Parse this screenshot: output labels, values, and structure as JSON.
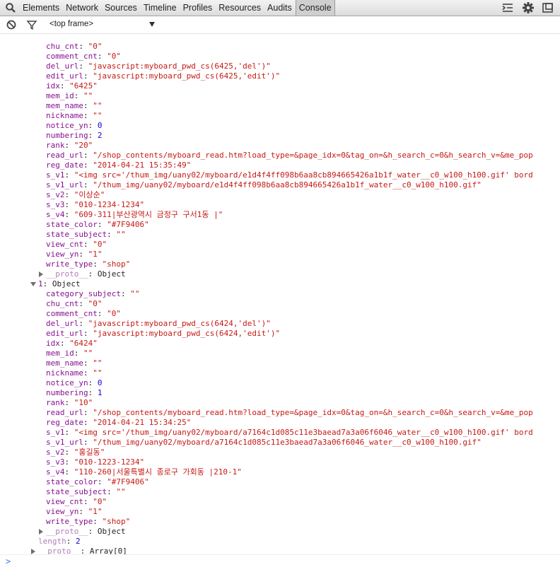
{
  "toolbar": {
    "tabs": [
      "Elements",
      "Network",
      "Sources",
      "Timeline",
      "Profiles",
      "Resources",
      "Audits",
      "Console"
    ],
    "active_tab": "Console"
  },
  "filterbar": {
    "frame_label": "<top frame>"
  },
  "console": {
    "obj0": [
      {
        "k": "chu_cnt",
        "v": "\"0\"",
        "t": "s"
      },
      {
        "k": "comment_cnt",
        "v": "\"0\"",
        "t": "s"
      },
      {
        "k": "del_url",
        "v": "\"javascript:myboard_pwd_cs(6425,'del')\"",
        "t": "s"
      },
      {
        "k": "edit_url",
        "v": "\"javascript:myboard_pwd_cs(6425,'edit')\"",
        "t": "s"
      },
      {
        "k": "idx",
        "v": "\"6425\"",
        "t": "s"
      },
      {
        "k": "mem_id",
        "v": "\"\"",
        "t": "s"
      },
      {
        "k": "mem_name",
        "v": "\"\"",
        "t": "s"
      },
      {
        "k": "nickname",
        "v": "\"\"",
        "t": "s"
      },
      {
        "k": "notice_yn",
        "v": "0",
        "t": "n"
      },
      {
        "k": "numbering",
        "v": "2",
        "t": "n"
      },
      {
        "k": "rank",
        "v": "\"20\"",
        "t": "s"
      },
      {
        "k": "read_url",
        "v": "\"/shop_contents/myboard_read.htm?load_type=&page_idx=0&tag_on=&h_search_c=0&h_search_v=&me_pop",
        "t": "s"
      },
      {
        "k": "reg_date",
        "v": "\"2014-04-21 15:35:49\"",
        "t": "s"
      },
      {
        "k": "s_v1",
        "v": "\"<img src='/thum_img/uany02/myboard/e1d4f4ff098b6aa8cb894665426a1b1f_water__c0_w100_h100.gif' bord",
        "t": "s"
      },
      {
        "k": "s_v1_url",
        "v": "\"/thum_img/uany02/myboard/e1d4f4ff098b6aa8cb894665426a1b1f_water__c0_w100_h100.gif\"",
        "t": "s"
      },
      {
        "k": "s_v2",
        "v": "\"이상순\"",
        "t": "s"
      },
      {
        "k": "s_v3",
        "v": "\"010-1234-1234\"",
        "t": "s"
      },
      {
        "k": "s_v4",
        "v": "\"609-311|부산광역시 금정구 구서1동 |\"",
        "t": "s"
      },
      {
        "k": "state_color",
        "v": "\"#7F9406\"",
        "t": "s"
      },
      {
        "k": "state_subject",
        "v": "\"\"",
        "t": "s"
      },
      {
        "k": "view_cnt",
        "v": "\"0\"",
        "t": "s"
      },
      {
        "k": "view_yn",
        "v": "\"1\"",
        "t": "s"
      },
      {
        "k": "write_type",
        "v": "\"shop\"",
        "t": "s"
      }
    ],
    "proto_label": "__proto__",
    "proto_object": "Object",
    "obj1_header_key": "1",
    "obj1_header_val": "Object",
    "obj1": [
      {
        "k": "category_subject",
        "v": "\"\"",
        "t": "s"
      },
      {
        "k": "chu_cnt",
        "v": "\"0\"",
        "t": "s"
      },
      {
        "k": "comment_cnt",
        "v": "\"0\"",
        "t": "s"
      },
      {
        "k": "del_url",
        "v": "\"javascript:myboard_pwd_cs(6424,'del')\"",
        "t": "s"
      },
      {
        "k": "edit_url",
        "v": "\"javascript:myboard_pwd_cs(6424,'edit')\"",
        "t": "s"
      },
      {
        "k": "idx",
        "v": "\"6424\"",
        "t": "s"
      },
      {
        "k": "mem_id",
        "v": "\"\"",
        "t": "s"
      },
      {
        "k": "mem_name",
        "v": "\"\"",
        "t": "s"
      },
      {
        "k": "nickname",
        "v": "\"\"",
        "t": "s"
      },
      {
        "k": "notice_yn",
        "v": "0",
        "t": "n"
      },
      {
        "k": "numbering",
        "v": "1",
        "t": "n"
      },
      {
        "k": "rank",
        "v": "\"10\"",
        "t": "s"
      },
      {
        "k": "read_url",
        "v": "\"/shop_contents/myboard_read.htm?load_type=&page_idx=0&tag_on=&h_search_c=0&h_search_v=&me_pop",
        "t": "s"
      },
      {
        "k": "reg_date",
        "v": "\"2014-04-21 15:34:25\"",
        "t": "s"
      },
      {
        "k": "s_v1",
        "v": "\"<img src='/thum_img/uany02/myboard/a7164c1d085c11e3baead7a3a06f6046_water__c0_w100_h100.gif' bord",
        "t": "s"
      },
      {
        "k": "s_v1_url",
        "v": "\"/thum_img/uany02/myboard/a7164c1d085c11e3baead7a3a06f6046_water__c0_w100_h100.gif\"",
        "t": "s"
      },
      {
        "k": "s_v2",
        "v": "\"홍길동\"",
        "t": "s"
      },
      {
        "k": "s_v3",
        "v": "\"010-1223-1234\"",
        "t": "s"
      },
      {
        "k": "s_v4",
        "v": "\"110-260|서울특별시 종로구 가회동 |210-1\"",
        "t": "s"
      },
      {
        "k": "state_color",
        "v": "\"#7F9406\"",
        "t": "s"
      },
      {
        "k": "state_subject",
        "v": "\"\"",
        "t": "s"
      },
      {
        "k": "view_cnt",
        "v": "\"0\"",
        "t": "s"
      },
      {
        "k": "view_yn",
        "v": "\"1\"",
        "t": "s"
      },
      {
        "k": "write_type",
        "v": "\"shop\"",
        "t": "s"
      }
    ],
    "length_key": "length",
    "length_val": "2",
    "array_proto": "Array[0]"
  },
  "prompt": {
    "glyph": ">"
  },
  "colors": {
    "key": "#881391",
    "string": "#c41a16",
    "number": "#1c00cf"
  }
}
